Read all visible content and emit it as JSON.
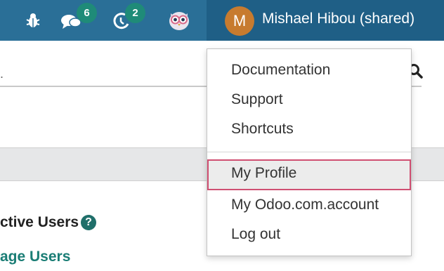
{
  "topbar": {
    "icons": [
      {
        "name": "bug-icon"
      },
      {
        "name": "chat-icon",
        "badge": "6"
      },
      {
        "name": "activity-icon",
        "badge": "2"
      },
      {
        "name": "owl-icon"
      }
    ]
  },
  "user": {
    "avatar_initial": "M",
    "name": "Mishael Hibou (shared)"
  },
  "search": {
    "leading_text": "."
  },
  "background": {
    "active_users_label": "ctive Users",
    "help_glyph": "?",
    "manage_users_label": "age Users"
  },
  "dropdown": {
    "items": [
      {
        "label": "Documentation"
      },
      {
        "label": "Support"
      },
      {
        "label": "Shortcuts"
      },
      {
        "label": "My Profile",
        "highlighted": true
      },
      {
        "label": "My Odoo.com.account"
      },
      {
        "label": "Log out"
      }
    ]
  },
  "colors": {
    "topbar": "#2a6f97",
    "user_area": "#1f5f86",
    "badge": "#1f8b78",
    "avatar": "#c77b2f",
    "highlight_border": "#d04f72",
    "link_teal": "#1a7d75"
  }
}
